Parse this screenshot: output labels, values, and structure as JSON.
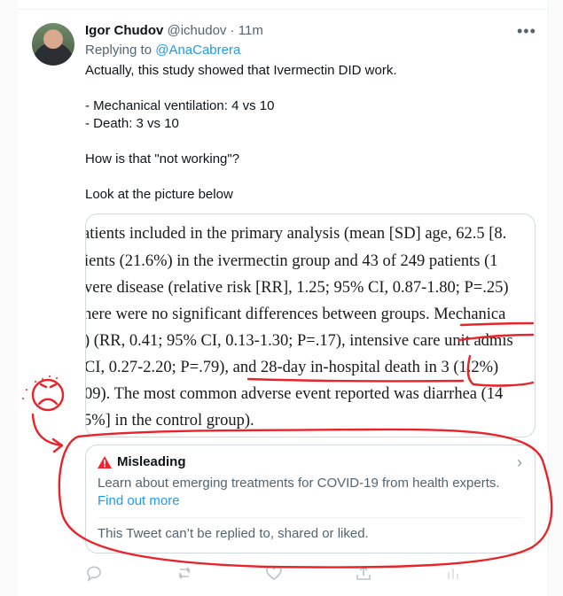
{
  "tweet": {
    "author_name": "Igor Chudov",
    "handle": "@ichudov",
    "separator": "·",
    "time": "11m",
    "more": "•••",
    "replying_to_prefix": "Replying to",
    "replying_to_mention": "@AnaCabrera",
    "body": [
      "Actually, this study showed that Ivermectin DID work.",
      "- Mechanical ventilation: 4 vs 10",
      "- Death: 3 vs 10",
      "How is that \"not working\"?",
      "Look at the picture below"
    ]
  },
  "image_excerpt": [
    "atients included in the primary analysis (mean [SD] age, 62.5 [8.",
    "ients (21.6%) in the ivermectin group and 43 of 249 patients (1",
    "vere disease (relative risk [RR], 1.25; 95% CI, 0.87-1.80; P=.25)",
    "here were no significant differences between groups. Mechanica",
    ") (RR, 0.41; 95% CI, 0.13-1.30; P=.17), intensive care unit admis",
    "CI, 0.27-2.20; P=.79), and 28-day in-hospital death in 3 (1.2%)",
    "09). The most common adverse event reported was diarrhea (14",
    "5%] in the control group)."
  ],
  "notice": {
    "title": "Misleading",
    "text": "Learn about emerging treatments for COVID-19 from health experts.",
    "link": "Find out more",
    "restriction": "This Tweet can’t be replied to, shared or liked."
  },
  "colors": {
    "link": "#1d9bf0",
    "warning": "#f4212e",
    "annotation": "#e8242a",
    "muted": "#536471"
  },
  "icons": [
    "warning-icon",
    "chevron-right-icon",
    "reply-icon",
    "retweet-icon",
    "like-icon",
    "share-icon",
    "analytics-icon"
  ]
}
